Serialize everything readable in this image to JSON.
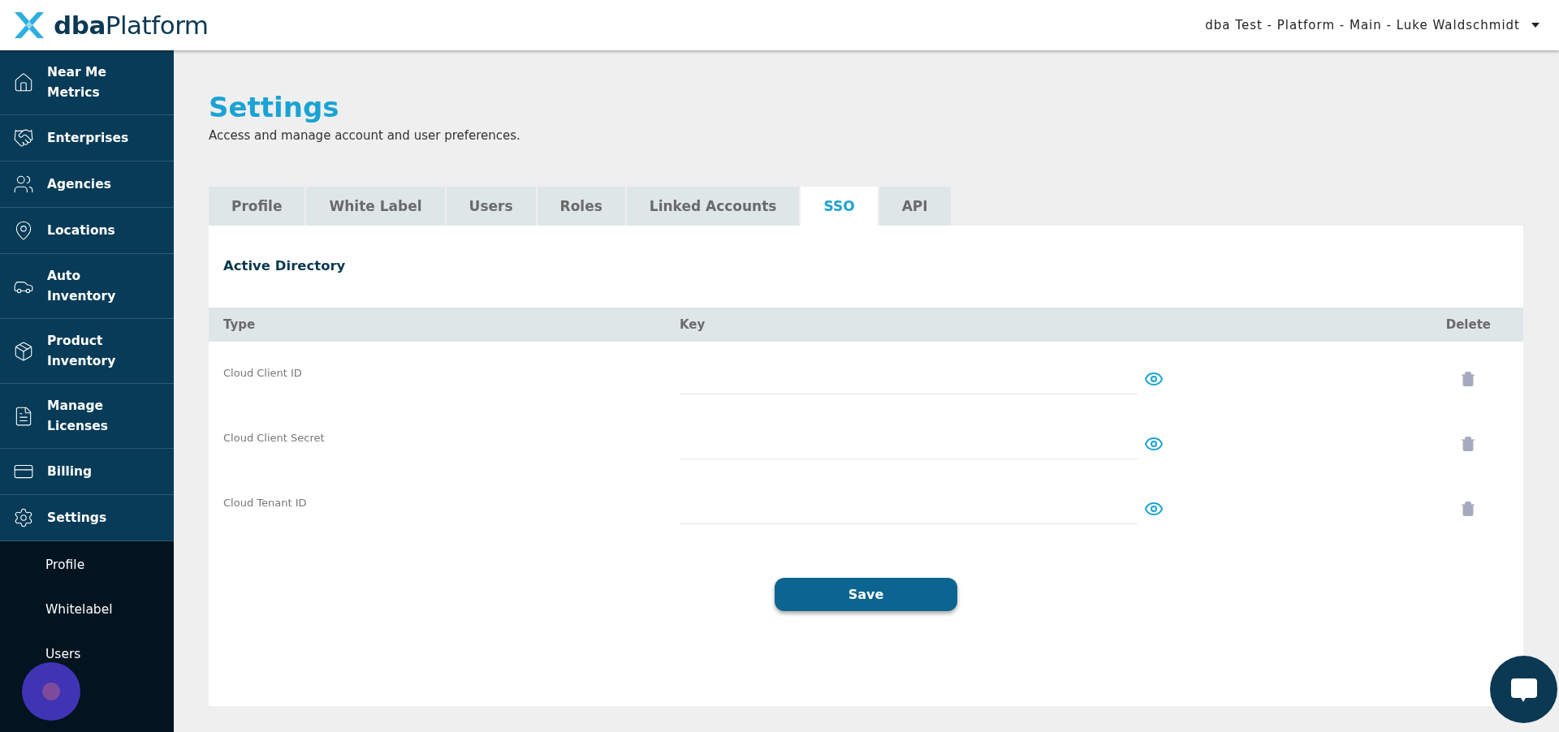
{
  "header": {
    "logo": {
      "bold": "dba",
      "light": "Platform"
    },
    "account": "dba Test - Platform - Main - Luke Waldschmidt"
  },
  "sidebar": {
    "items": [
      {
        "label": "Near Me Metrics"
      },
      {
        "label": "Enterprises"
      },
      {
        "label": "Agencies"
      },
      {
        "label": "Locations"
      },
      {
        "label": "Auto Inventory"
      },
      {
        "label": "Product Inventory"
      },
      {
        "label": "Manage Licenses"
      },
      {
        "label": "Billing"
      },
      {
        "label": "Settings",
        "children": [
          {
            "label": "Profile"
          },
          {
            "label": "Whitelabel"
          },
          {
            "label": "Users"
          }
        ]
      }
    ]
  },
  "page": {
    "title": "Settings",
    "subtitle": "Access and manage account and user preferences."
  },
  "tabs": [
    {
      "label": "Profile",
      "selected": false
    },
    {
      "label": "White Label",
      "selected": false
    },
    {
      "label": "Users",
      "selected": false
    },
    {
      "label": "Roles",
      "selected": false
    },
    {
      "label": "Linked Accounts",
      "selected": false
    },
    {
      "label": "SSO",
      "selected": true
    },
    {
      "label": "API",
      "selected": false
    }
  ],
  "section": {
    "title": "Active Directory"
  },
  "table": {
    "columns": [
      "Type",
      "Key",
      "Delete"
    ],
    "rows": [
      {
        "type": "Cloud Client ID"
      },
      {
        "type": "Cloud Client Secret"
      },
      {
        "type": "Cloud Tenant ID"
      }
    ]
  },
  "save_button": "Save"
}
